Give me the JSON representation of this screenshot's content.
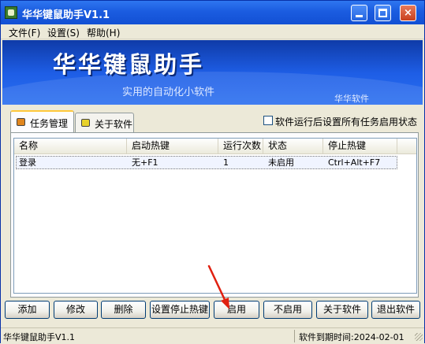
{
  "window": {
    "title": "华华键鼠助手V1.1",
    "controls": {
      "minimize": "minimize",
      "maximize": "maximize",
      "close": "×"
    }
  },
  "menu": [
    {
      "label": "文件(F)"
    },
    {
      "label": "设置(S)"
    },
    {
      "label": "帮助(H)"
    }
  ],
  "banner": {
    "title": "华华键鼠助手",
    "subtitle": "实用的自动化小软件",
    "corner": "华华软件"
  },
  "tabs": [
    {
      "label": "任务管理",
      "icon": "task-icon",
      "active": true
    },
    {
      "label": "关于软件",
      "icon": "about-icon",
      "active": false
    }
  ],
  "options": {
    "auto_enable_label": "软件运行后设置所有任务启用状态",
    "auto_enable_checked": false
  },
  "table": {
    "columns": [
      "名称",
      "启动热键",
      "运行次数",
      "状态",
      "停止热键"
    ],
    "rows": [
      {
        "name": "登录",
        "start_hotkey": "无+F1",
        "run_count": "1",
        "status": "未启用",
        "stop_hotkey": "Ctrl+Alt+F7"
      }
    ]
  },
  "buttons": {
    "add": "添加",
    "edit": "修改",
    "delete": "删除",
    "set_stop_hotkey": "设置停止热键",
    "enable": "启用",
    "disable": "不启用",
    "about": "关于软件",
    "exit": "退出软件"
  },
  "status": {
    "app_name": "华华键鼠助手V1.1",
    "expiry": "软件到期时间:2024-02-01"
  },
  "colors": {
    "titlebar": "#1B5CE0",
    "banner": "#1E5EE6",
    "annotation_arrow": "#E02010"
  }
}
